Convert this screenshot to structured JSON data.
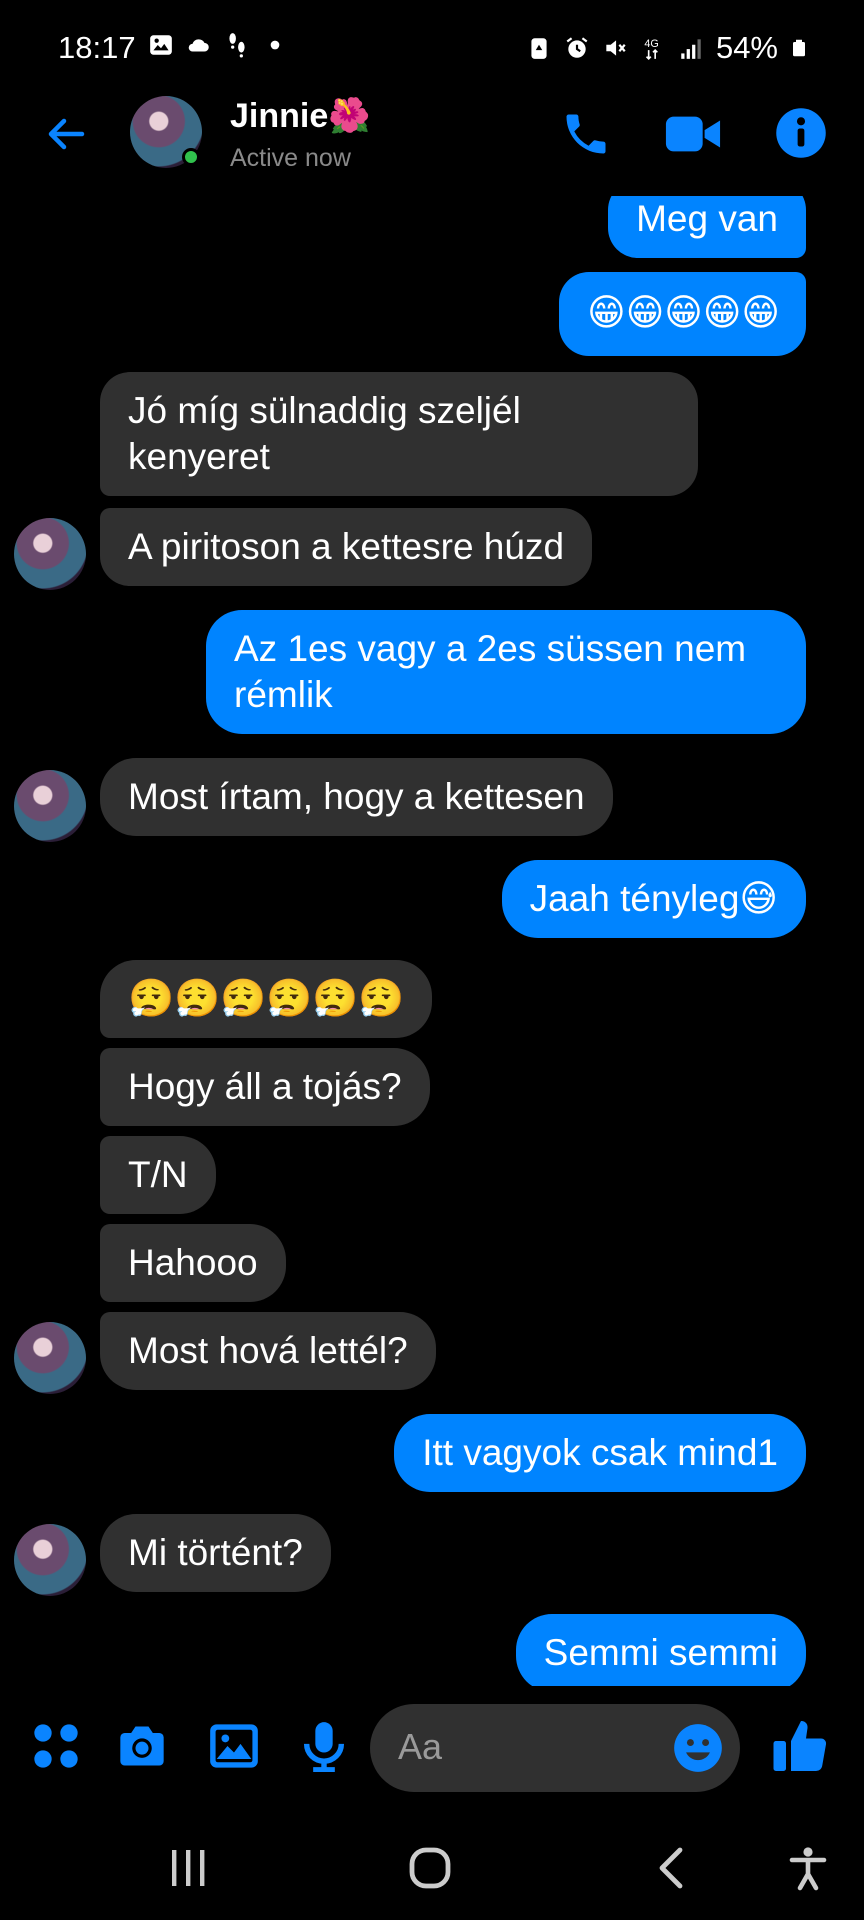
{
  "status_bar": {
    "time": "18:17",
    "battery": "54%",
    "network": "4G"
  },
  "header": {
    "contact_name": "Jinnie🌺",
    "status": "Active now"
  },
  "messages": [
    {
      "side": "out",
      "text": "Meg van"
    },
    {
      "side": "out",
      "text": "😁😁😁😁😁"
    },
    {
      "side": "in",
      "text": "Jó míg sülnaddig szeljél kenyeret"
    },
    {
      "side": "in",
      "text": "A piritoson a kettesre húzd"
    },
    {
      "side": "out",
      "text": "Az 1es vagy a 2es süssen nem rémlik"
    },
    {
      "side": "in",
      "text": "Most írtam, hogy a kettesen"
    },
    {
      "side": "out",
      "text": "Jaah tényleg😅"
    },
    {
      "side": "in",
      "text": "😮‍💨😮‍💨😮‍💨😮‍💨😮‍💨😮‍💨"
    },
    {
      "side": "in",
      "text": "Hogy áll a tojás?"
    },
    {
      "side": "in",
      "text": "T/N"
    },
    {
      "side": "in",
      "text": "Hahooo"
    },
    {
      "side": "in",
      "text": "Most hová lettél?"
    },
    {
      "side": "out",
      "text": "Itt vagyok csak mind1"
    },
    {
      "side": "in",
      "text": "Mi történt?"
    },
    {
      "side": "out",
      "text": "Semmi semmi"
    }
  ],
  "composer": {
    "placeholder": "Aa"
  },
  "colors": {
    "accent": "#0084ff",
    "incoming_bubble": "#303030",
    "background": "#000000",
    "active_dot": "#31c24d"
  },
  "icons": [
    "back-arrow-icon",
    "phone-icon",
    "video-camera-icon",
    "info-icon",
    "menu-dots-icon",
    "camera-icon",
    "gallery-icon",
    "microphone-icon",
    "emoji-icon",
    "thumbs-up-icon",
    "recents-icon",
    "home-icon",
    "nav-back-icon",
    "accessibility-icon"
  ]
}
